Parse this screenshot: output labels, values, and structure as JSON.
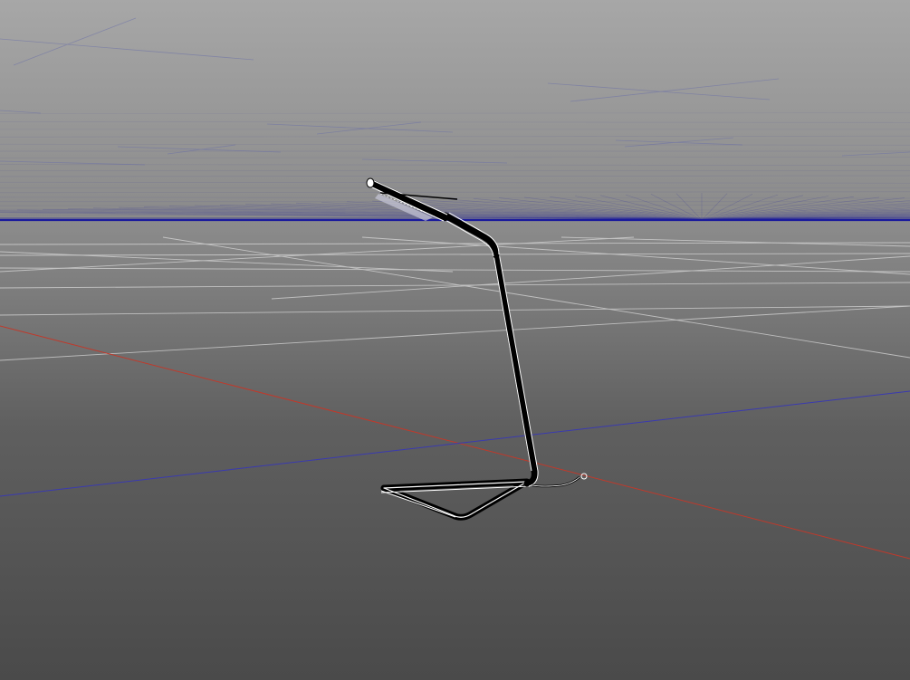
{
  "viewport": {
    "view": "perspective",
    "render_style": "wireframe",
    "background": {
      "sky_top": "#a7a7a7",
      "sky_horizon": "#8a8a8a",
      "floor_far": "#8c8c8c",
      "floor_near": "#4a4a4a"
    },
    "horizon_color": "#1a1a9c",
    "grid_color": "#d8d8d8",
    "x_axis_color": "#c0392b",
    "z_axis_color": "#3a3ab0",
    "wire_color": "#ffffff",
    "solid_color": "#000000",
    "grid_visible": true
  },
  "scene": {
    "object": "desk-lamp",
    "parts": [
      "lamp-head",
      "lamp-neck",
      "lamp-stem",
      "lamp-base",
      "power-cord"
    ]
  }
}
